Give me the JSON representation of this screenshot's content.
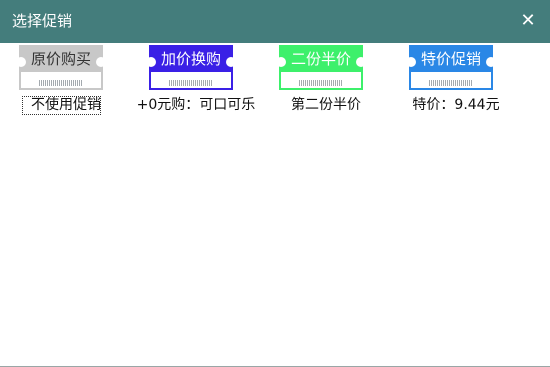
{
  "window": {
    "title": "选择促销",
    "close_glyph": "✕"
  },
  "coupons": [
    {
      "badge": "原价购买",
      "caption": "不使用促销",
      "color": "#c8c8c8",
      "head_text_color": "#333333",
      "selected": true
    },
    {
      "badge": "加价换购",
      "caption": "+0元购：可口可乐",
      "color": "#3a20e6",
      "head_text_color": "#ffffff",
      "selected": false
    },
    {
      "badge": "二份半价",
      "caption": "第二份半价",
      "color": "#3df06b",
      "head_text_color": "#ffffff",
      "selected": false
    },
    {
      "badge": "特价促销",
      "caption": "特价：9.44元",
      "color": "#2a87e6",
      "head_text_color": "#ffffff",
      "selected": false
    }
  ]
}
